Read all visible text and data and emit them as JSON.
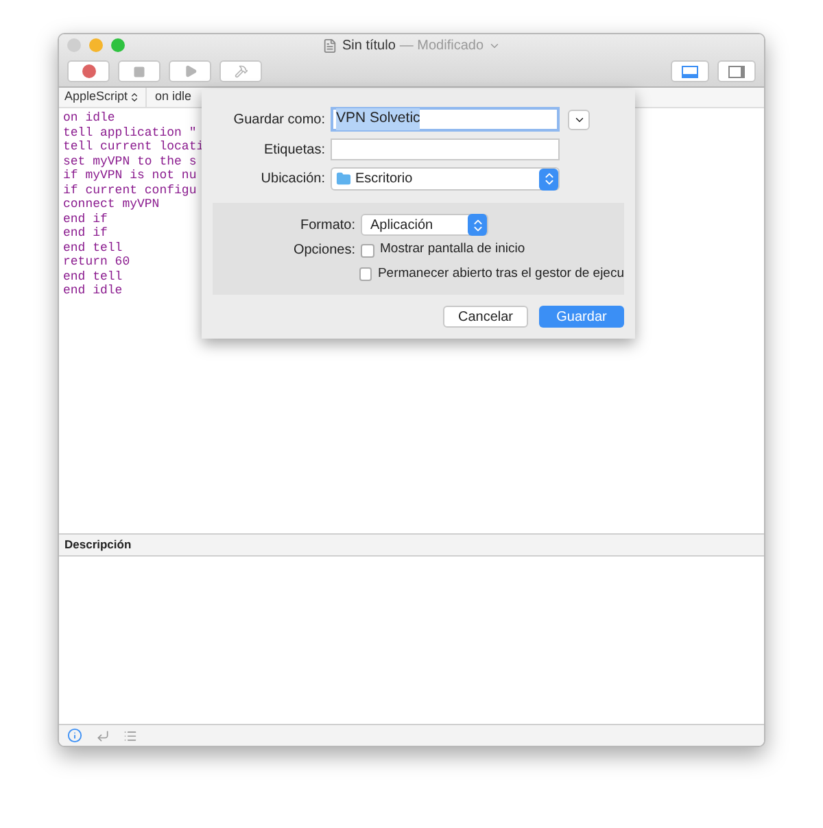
{
  "window": {
    "title": "Sin título",
    "subtitle": "— Modificado"
  },
  "toolbar": {
    "record": {
      "disabled": false
    },
    "stop": {
      "disabled": true
    },
    "run": {
      "disabled": true
    },
    "compile": {
      "disabled": true
    }
  },
  "navigation": {
    "language": "AppleScript",
    "handler": "on idle"
  },
  "editor": {
    "lines": [
      "on idle",
      "tell application \"",
      "tell current locati",
      "set myVPN to the s",
      "if myVPN is not nu",
      "if current configu",
      "connect myVPN",
      "end if",
      "end if",
      "end tell",
      "return 60",
      "end tell",
      "end idle"
    ]
  },
  "save_sheet": {
    "save_as_label": "Guardar como:",
    "save_as_value": "VPN Solvetic",
    "tags_label": "Etiquetas:",
    "location_label": "Ubicación:",
    "location_value": "Escritorio",
    "format_label": "Formato:",
    "format_value": "Aplicación",
    "options_label": "Opciones:",
    "options": [
      {
        "label": "Mostrar pantalla de inicio",
        "checked": false
      },
      {
        "label": "Permanecer abierto tras el gestor de ejecu",
        "checked": false
      }
    ],
    "cancel": "Cancelar",
    "save": "Guardar"
  },
  "description": {
    "title": "Descripción"
  },
  "bottom_bar": {
    "info_selected": true
  }
}
